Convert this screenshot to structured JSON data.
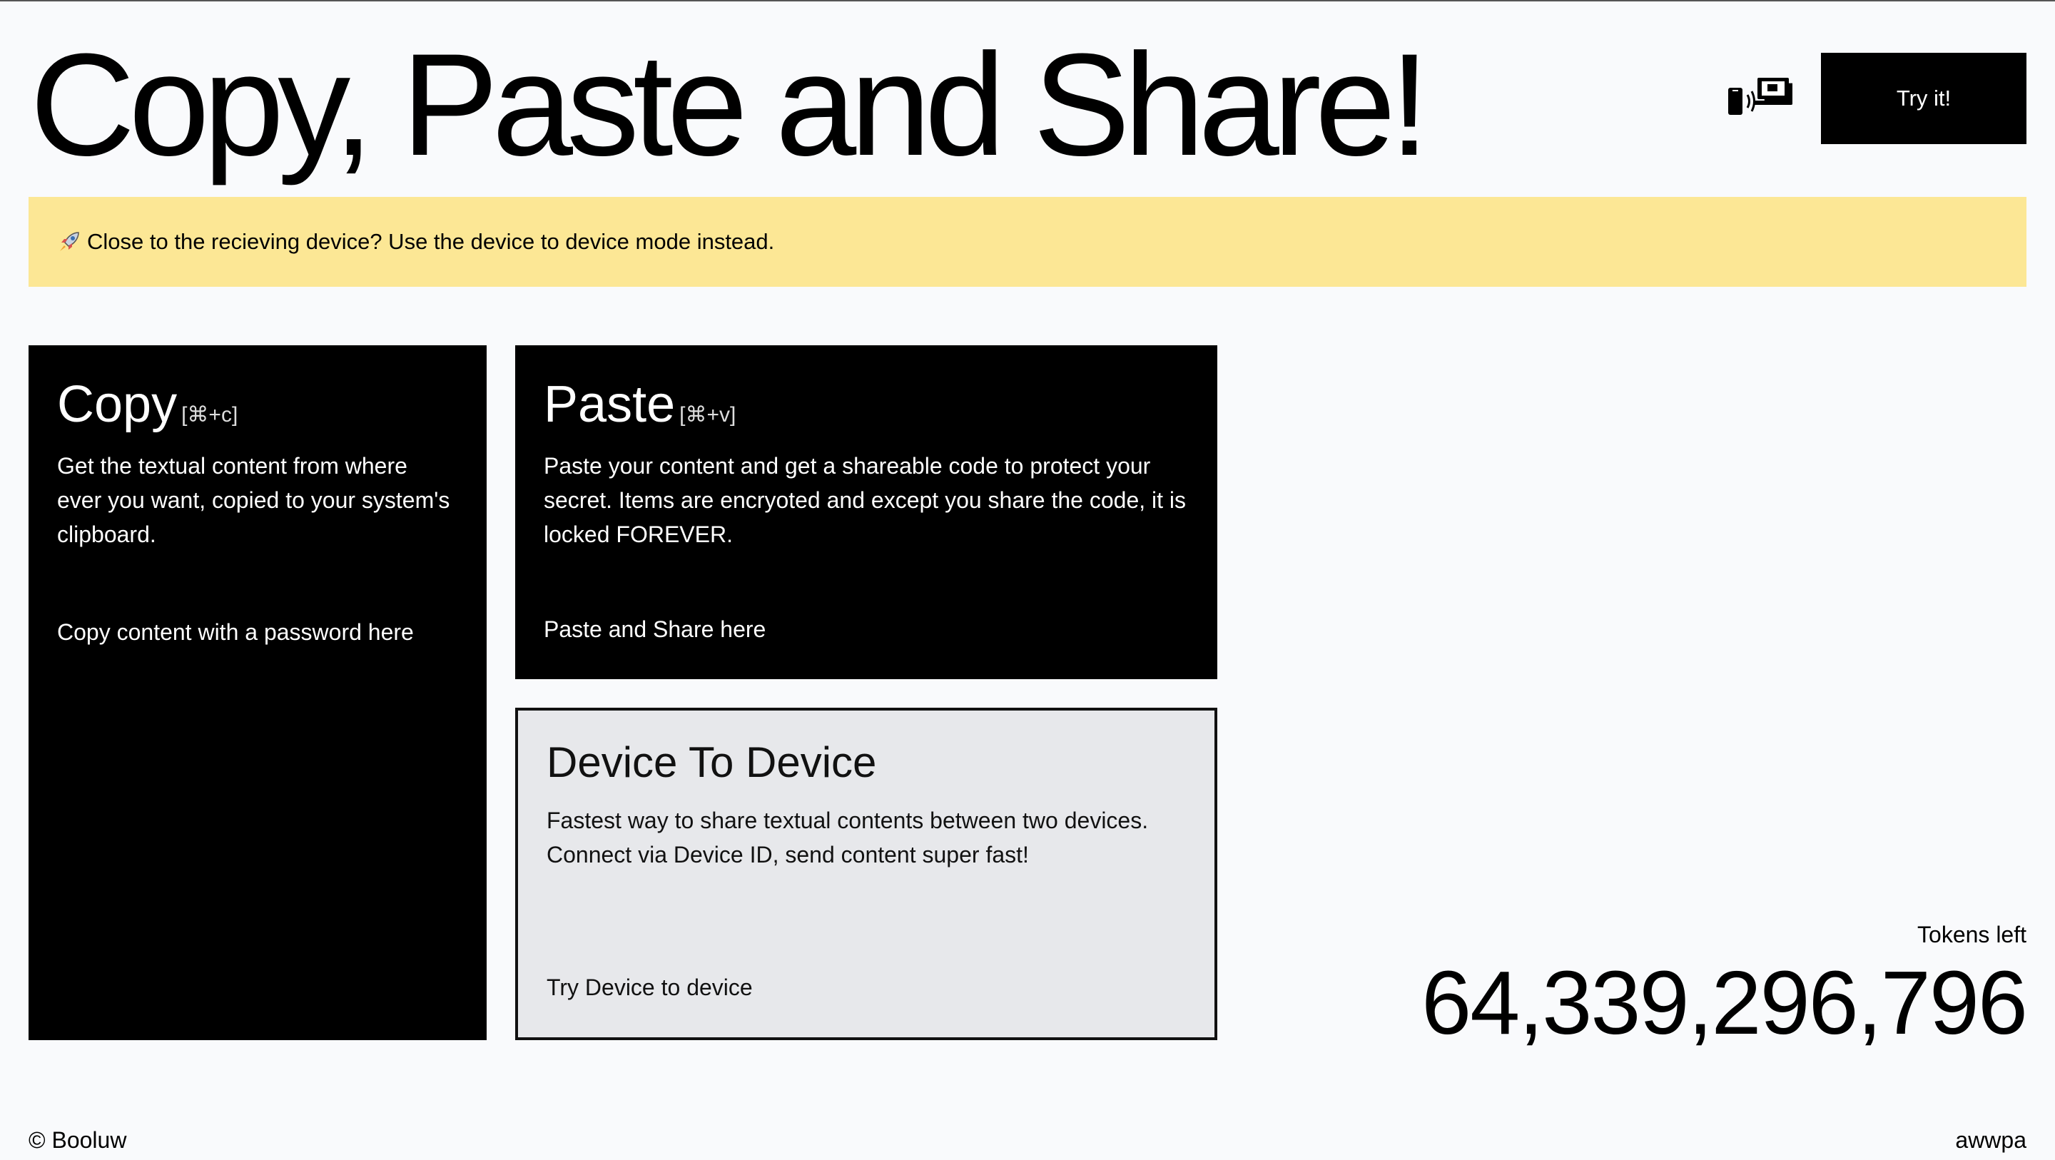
{
  "header": {
    "title": "Copy, Paste and Share!",
    "icon": "phone-to-laptop-icon",
    "try_label": "Try it!"
  },
  "banner": {
    "icon": "rocket-icon",
    "text": "Close to the recieving device? Use the device to device mode instead."
  },
  "cards": {
    "copy": {
      "title": "Copy",
      "shortcut": "[⌘+c]",
      "description": "Get the textual content from where ever you want, copied to your system's clipboard.",
      "link": "Copy content with a password here"
    },
    "paste": {
      "title": "Paste",
      "shortcut": "[⌘+v]",
      "description": "Paste your content and get a shareable code to protect your secret. Items are encryoted and except you share the code, it is locked FOREVER.",
      "link": "Paste and Share here"
    },
    "device_to_device": {
      "title": "Device To Device",
      "description": "Fastest way to share textual contents between two devices. Connect via Device ID, send content super fast!",
      "link": "Try Device to device"
    }
  },
  "tokens": {
    "label": "Tokens left",
    "count": "64,339,296,796"
  },
  "footer": {
    "copyright": "© Booluw",
    "right": "awwpa"
  },
  "colors": {
    "background": "#f9fafc",
    "banner": "#fce795",
    "dark_card": "#000000",
    "light_card": "#e7e8eb"
  }
}
